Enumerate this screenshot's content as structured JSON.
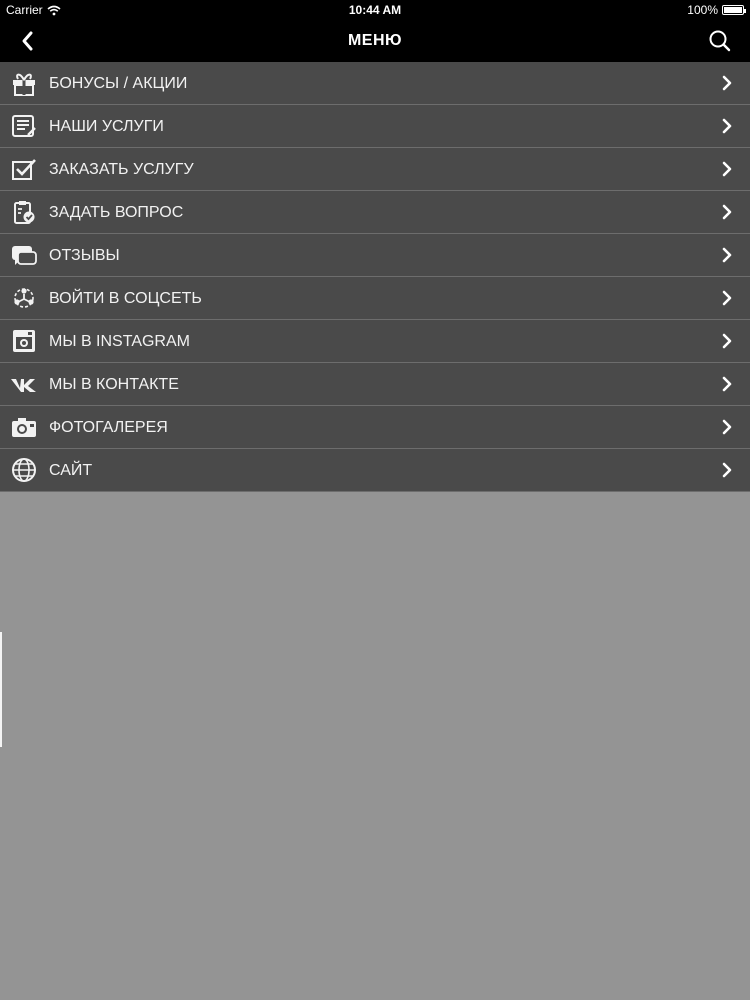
{
  "status_bar": {
    "carrier": "Carrier",
    "time": "10:44 AM",
    "battery": "100%",
    "wifi_icon": "wifi-icon",
    "battery_icon": "battery-icon"
  },
  "navbar": {
    "title": "МЕНЮ",
    "back_icon": "chevron-left-icon",
    "search_icon": "search-icon"
  },
  "menu": {
    "items": [
      {
        "label": "БОНУСЫ / АКЦИИ",
        "icon": "gift-icon"
      },
      {
        "label": "НАШИ УСЛУГИ",
        "icon": "service-list-icon"
      },
      {
        "label": "ЗАКАЗАТЬ УСЛУГУ",
        "icon": "checkbox-icon"
      },
      {
        "label": "ЗАДАТЬ ВОПРОС",
        "icon": "clipboard-check-icon"
      },
      {
        "label": "ОТЗЫВЫ",
        "icon": "chat-bubbles-icon"
      },
      {
        "label": "ВОЙТИ В СОЦСЕТЬ",
        "icon": "social-network-icon"
      },
      {
        "label": "МЫ В INSTAGRAM",
        "icon": "instagram-icon"
      },
      {
        "label": "МЫ В КОНТАКТЕ",
        "icon": "vk-icon"
      },
      {
        "label": "ФОТОГАЛЕРЕЯ",
        "icon": "camera-icon"
      },
      {
        "label": "САЙТ",
        "icon": "globe-icon"
      }
    ],
    "chevron_icon": "chevron-right-icon"
  },
  "colors": {
    "bar_background": "#000000",
    "menu_background": "#4a4a4a",
    "page_background": "#949494",
    "text": "#f2f2f2"
  }
}
